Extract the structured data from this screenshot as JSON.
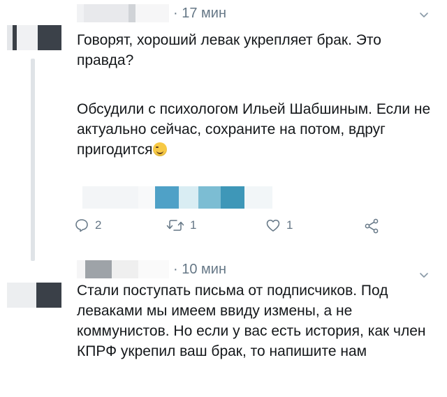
{
  "tweets": [
    {
      "time": "· 17 мин",
      "paragraphs": [
        "Говорят, хороший левак укрепляет брак. Это правда?",
        "Обсудили с психологом Ильей Шабшиным. Если не актуально сейчас, сохраните на потом, вдруг пригодится"
      ],
      "emoji": "winking-face",
      "actions": {
        "replies": "2",
        "retweets": "1",
        "likes": "1"
      }
    },
    {
      "time": "· 10 мин",
      "text": "Стали поступать письма от подписчиков. Под леваками мы имеем ввиду измены, а не коммунистов. Но если у вас есть история, как член КПРФ укрепил ваш брак, то напишите нам"
    }
  ],
  "colors": {
    "text": "#14171a",
    "muted": "#657786",
    "thread_line": "#dfe3e7",
    "link_accent": "#4fa1c7"
  }
}
